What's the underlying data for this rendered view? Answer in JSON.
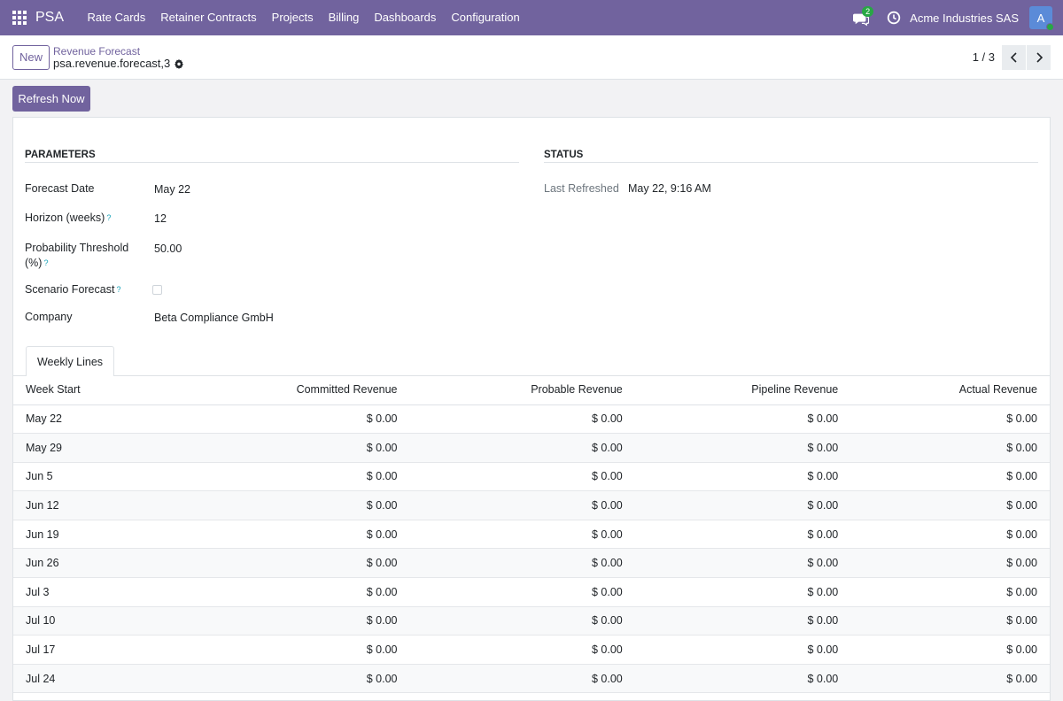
{
  "nav": {
    "brand": "PSA",
    "menu": [
      "Rate Cards",
      "Retainer Contracts",
      "Projects",
      "Billing",
      "Dashboards",
      "Configuration"
    ],
    "chat_badge": "2",
    "company": "Acme Industries SAS",
    "avatar_letter": "A"
  },
  "control": {
    "new_label": "New",
    "breadcrumb_parent": "Revenue Forecast",
    "breadcrumb_current": "psa.revenue.forecast,3",
    "pager": "1 / 3"
  },
  "actions": {
    "refresh_label": "Refresh Now"
  },
  "parameters": {
    "title": "PARAMETERS",
    "forecast_date_label": "Forecast Date",
    "forecast_date": "May 22",
    "horizon_label": "Horizon (weeks)",
    "horizon": "12",
    "probability_label": "Probability Threshold (%)",
    "probability": "50.00",
    "scenario_label": "Scenario Forecast",
    "company_label": "Company",
    "company": "Beta Compliance GmbH",
    "help": "?"
  },
  "status": {
    "title": "STATUS",
    "last_refreshed_label": "Last Refreshed",
    "last_refreshed": "May 22, 9:16 AM"
  },
  "tabs": {
    "weekly_lines": "Weekly Lines"
  },
  "table": {
    "headers": [
      "Week Start",
      "Committed Revenue",
      "Probable Revenue",
      "Pipeline Revenue",
      "Actual Revenue"
    ],
    "rows": [
      [
        "May 22",
        "$ 0.00",
        "$ 0.00",
        "$ 0.00",
        "$ 0.00"
      ],
      [
        "May 29",
        "$ 0.00",
        "$ 0.00",
        "$ 0.00",
        "$ 0.00"
      ],
      [
        "Jun 5",
        "$ 0.00",
        "$ 0.00",
        "$ 0.00",
        "$ 0.00"
      ],
      [
        "Jun 12",
        "$ 0.00",
        "$ 0.00",
        "$ 0.00",
        "$ 0.00"
      ],
      [
        "Jun 19",
        "$ 0.00",
        "$ 0.00",
        "$ 0.00",
        "$ 0.00"
      ],
      [
        "Jun 26",
        "$ 0.00",
        "$ 0.00",
        "$ 0.00",
        "$ 0.00"
      ],
      [
        "Jul 3",
        "$ 0.00",
        "$ 0.00",
        "$ 0.00",
        "$ 0.00"
      ],
      [
        "Jul 10",
        "$ 0.00",
        "$ 0.00",
        "$ 0.00",
        "$ 0.00"
      ],
      [
        "Jul 17",
        "$ 0.00",
        "$ 0.00",
        "$ 0.00",
        "$ 0.00"
      ],
      [
        "Jul 24",
        "$ 0.00",
        "$ 0.00",
        "$ 0.00",
        "$ 0.00"
      ]
    ]
  }
}
